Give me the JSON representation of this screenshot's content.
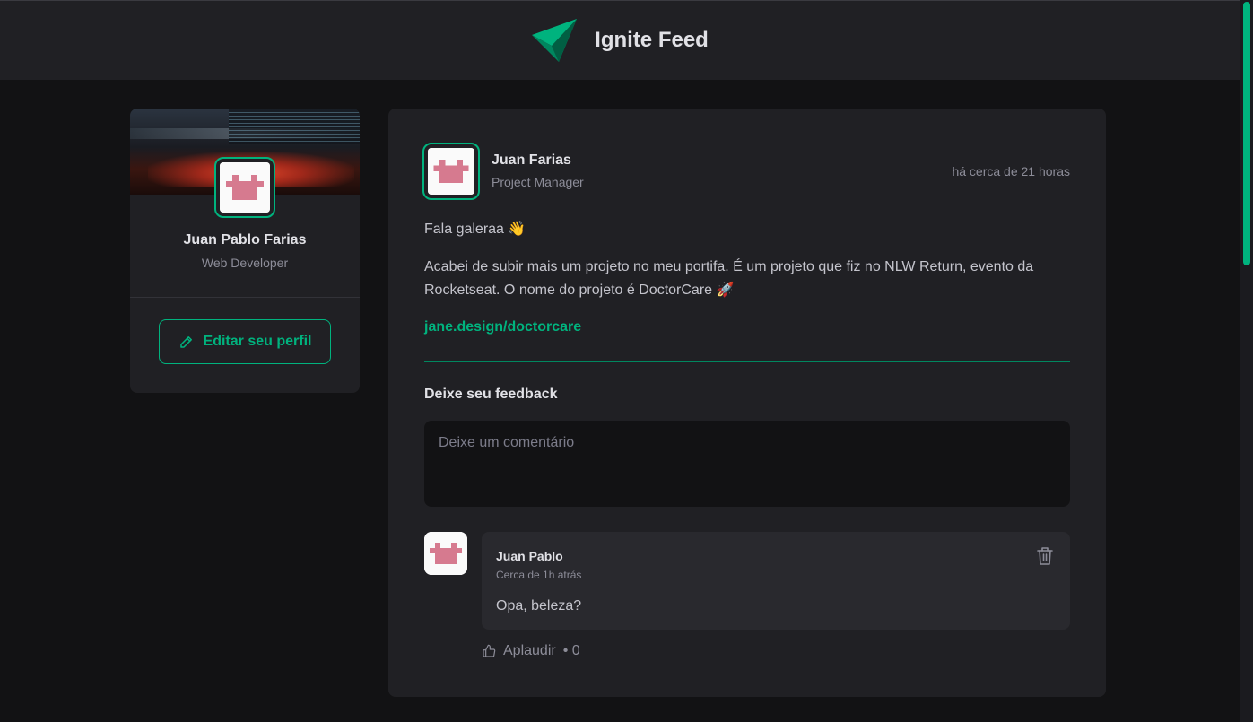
{
  "header": {
    "title": "Ignite Feed"
  },
  "sidebar": {
    "name": "Juan Pablo Farias",
    "role": "Web Developer",
    "edit_button_label": "Editar seu perfil"
  },
  "post": {
    "author_name": "Juan Farias",
    "author_role": "Project Manager",
    "time": "há cerca de 21 horas",
    "paragraphs": [
      "Fala galeraa 👋",
      "Acabei de subir mais um projeto no meu portifa. É um projeto que fiz no NLW Return, evento da Rocketseat. O nome do projeto é DoctorCare 🚀"
    ],
    "link": "jane.design/doctorcare",
    "feedback_title": "Deixe seu feedback",
    "comment_placeholder": "Deixe um comentário"
  },
  "comment": {
    "author": "Juan Pablo",
    "time": "Cerca de 1h atrás",
    "text": "Opa, beleza?",
    "applaud_label": "Aplaudir",
    "applaud_count": "• 0"
  },
  "colors": {
    "accent": "#00b37e",
    "background": "#121214",
    "card": "#202024",
    "comment_bg": "#29292e",
    "avatar_pink": "#d67a8f"
  },
  "icons": {
    "logo": "ignite-logo-icon",
    "edit": "pencil-icon",
    "trash": "trash-icon",
    "applaud": "thumbs-up-icon"
  }
}
